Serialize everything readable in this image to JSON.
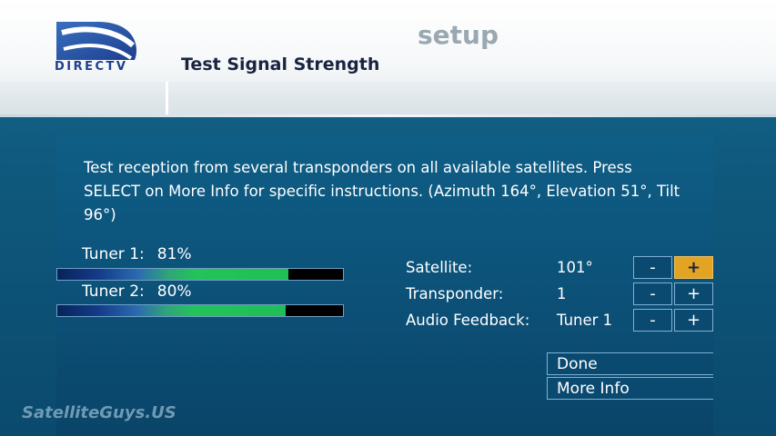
{
  "header": {
    "logo_text": "DIRECTV",
    "section": "setup",
    "title": "Test Signal Strength"
  },
  "instructions": "Test reception from several transponders on all available satellites. Press SELECT on More Info for specific instructions. (Azimuth 164°, Elevation 51°, Tilt 96°)",
  "tuners": [
    {
      "label": "Tuner 1:",
      "value": "81%",
      "strength": 0.81
    },
    {
      "label": "Tuner 2:",
      "value": "80%",
      "strength": 0.8
    }
  ],
  "settings": [
    {
      "label": "Satellite:",
      "value": "101°",
      "minus": "-",
      "plus": "+"
    },
    {
      "label": "Transponder:",
      "value": "1",
      "minus": "-",
      "plus": "+"
    },
    {
      "label": "Audio Feedback:",
      "value": "Tuner 1",
      "minus": "-",
      "plus": "+"
    }
  ],
  "actions": {
    "done": "Done",
    "more_info": "More Info"
  },
  "watermark": "SatelliteGuys.US",
  "colors": {
    "background": "#0f5a7e",
    "focus": "#e3a323",
    "signal": "#1fbf55"
  }
}
